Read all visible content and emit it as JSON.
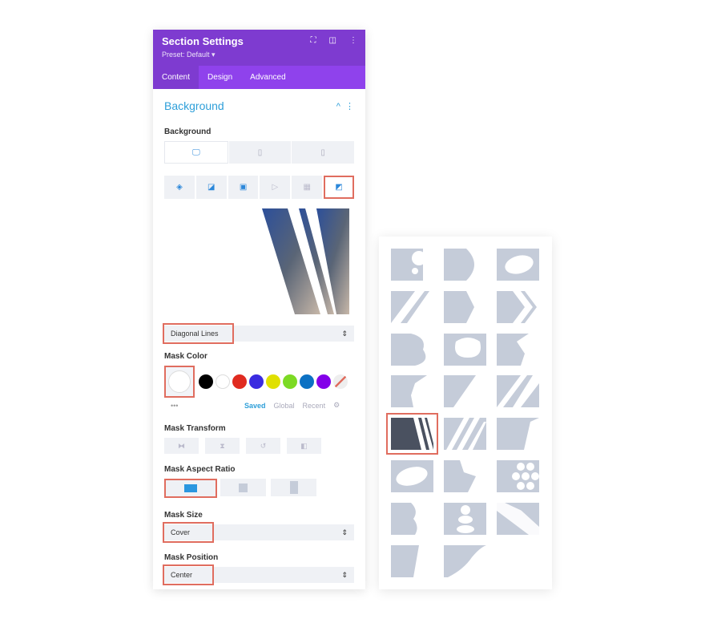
{
  "header": {
    "title": "Section Settings",
    "preset": "Preset: Default ▾",
    "icons": [
      "fullscreen-icon",
      "split-view-icon",
      "more-icon"
    ]
  },
  "tabs": [
    {
      "label": "Content",
      "active": true
    },
    {
      "label": "Design"
    },
    {
      "label": "Advanced"
    }
  ],
  "section": {
    "title": "Background",
    "collapse": "^",
    "menu": "⋮"
  },
  "background": {
    "label": "Background",
    "devices": [
      "desktop",
      "tablet",
      "phone"
    ],
    "types": [
      "color",
      "gradient",
      "image",
      "video",
      "pattern",
      "mask"
    ],
    "active_type": "mask"
  },
  "mask_style": {
    "value": "Diagonal Lines"
  },
  "mask_color": {
    "label": "Mask Color",
    "swatches": [
      "#000000",
      "#ffffff",
      "#e02b20",
      "#3a2be0",
      "#e0e000",
      "#7cda24",
      "#0c71c3",
      "#8300e9"
    ],
    "more": "•••",
    "tabs": [
      "Saved",
      "Global",
      "Recent"
    ],
    "active_tab": "Saved"
  },
  "mask_transform": {
    "label": "Mask Transform"
  },
  "mask_aspect": {
    "label": "Mask Aspect Ratio",
    "options": [
      "landscape",
      "square",
      "portrait"
    ],
    "selected": "landscape"
  },
  "mask_size": {
    "label": "Mask Size",
    "value": "Cover"
  },
  "mask_position": {
    "label": "Mask Position",
    "value": "Center"
  },
  "mask_library": {
    "count": 23,
    "selected_index": 12
  }
}
